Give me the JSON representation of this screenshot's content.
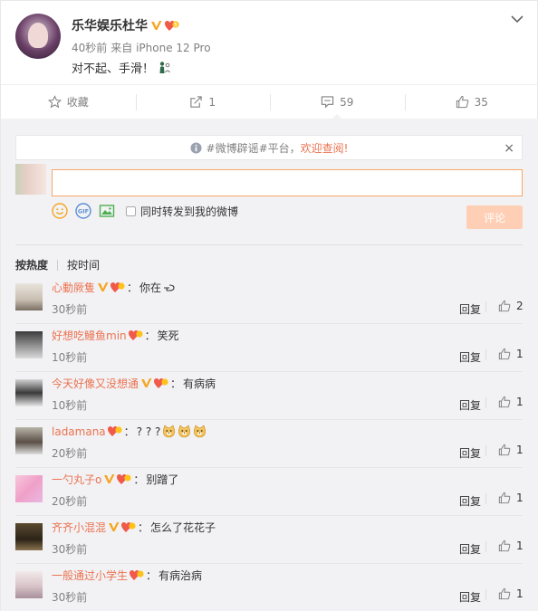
{
  "post": {
    "author": "乐华娱乐杜华",
    "time": "40秒前",
    "source": "来自 iPhone 12 Pro",
    "text": "对不起、手滑！"
  },
  "actions": [
    {
      "label": "收藏",
      "icon": "star-icon"
    },
    {
      "label": "1",
      "icon": "repost-icon"
    },
    {
      "label": "59",
      "icon": "comment-icon"
    },
    {
      "label": "35",
      "icon": "thumbs-up-icon"
    }
  ],
  "notice": {
    "prefix": "#微博辟谣#平台，",
    "link": "欢迎查阅!",
    "close": "×"
  },
  "composer": {
    "input_value": "",
    "repost_label": "同时转发到我的微博",
    "submit_label": "评论"
  },
  "sort": {
    "hot": "按热度",
    "time": "按时间"
  },
  "comments": [
    {
      "user": "心動厥隻",
      "text": "你在",
      "time": "30秒前",
      "reply": "回复",
      "likes": "2"
    },
    {
      "user": "好想吃鳗鱼min",
      "text": "笑死",
      "time": "10秒前",
      "reply": "回复",
      "likes": "1"
    },
    {
      "user": "今天好像又没想通",
      "text": "有病病",
      "time": "10秒前",
      "reply": "回复",
      "likes": "1"
    },
    {
      "user": "ladamana",
      "text": "? ? ?",
      "time": "20秒前",
      "reply": "回复",
      "likes": "1"
    },
    {
      "user": "一勺丸子o",
      "text": "别蹭了",
      "time": "20秒前",
      "reply": "回复",
      "likes": "1"
    },
    {
      "user": "齐齐小混混",
      "text": "怎么了花花子",
      "time": "30秒前",
      "reply": "回复",
      "likes": "1"
    },
    {
      "user": "一般通过小学生",
      "text": "有病治病",
      "time": "30秒前",
      "reply": "回复",
      "likes": "1"
    }
  ],
  "colors": {
    "accent": "#eb7350",
    "panel_bg": "#f2f2f5",
    "input_border": "#f8a668",
    "submit_bg": "#fecfb4"
  }
}
